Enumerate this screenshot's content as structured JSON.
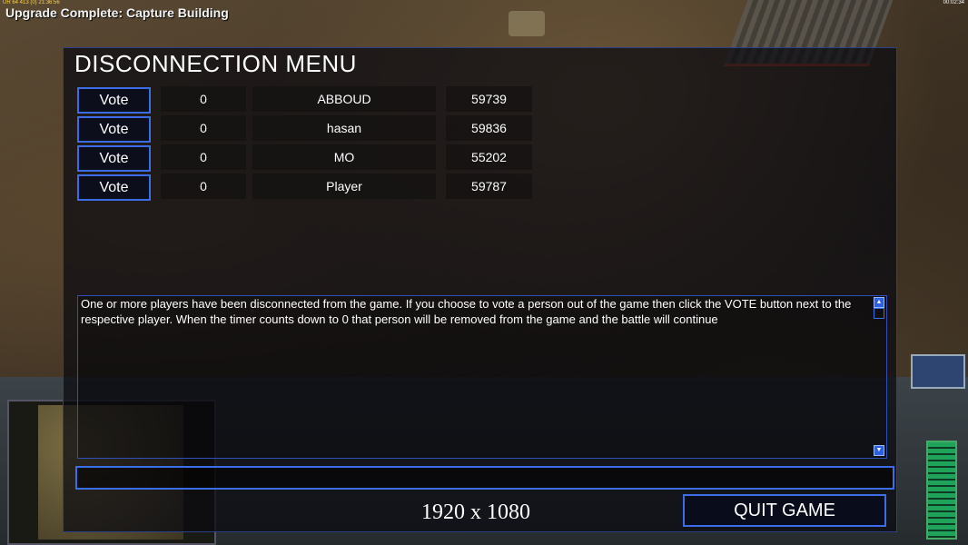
{
  "hud": {
    "debug_text": "UR 64 413 (0) 21:36:56",
    "clock": "00:02:34",
    "message": "Upgrade Complete: Capture Building"
  },
  "dialog": {
    "title": "DISCONNECTION MENU",
    "vote_label": "Vote",
    "players": [
      {
        "count": "0",
        "name": "ABBOUD",
        "id": "59739"
      },
      {
        "count": "0",
        "name": "hasan",
        "id": "59836"
      },
      {
        "count": "0",
        "name": "MO",
        "id": "55202"
      },
      {
        "count": "0",
        "name": "Player",
        "id": "59787"
      }
    ],
    "message": "One or more players have been disconnected from the game. If you choose to vote a person out of the game then click the VOTE button next to the respective player. When the timer counts down to 0 that person will be removed from the game and the battle will continue",
    "chat_value": "",
    "resolution": "1920 x 1080",
    "quit_label": "QUIT GAME"
  },
  "icons": {
    "scroll_up": "triangle-up",
    "scroll_down": "triangle-down"
  }
}
